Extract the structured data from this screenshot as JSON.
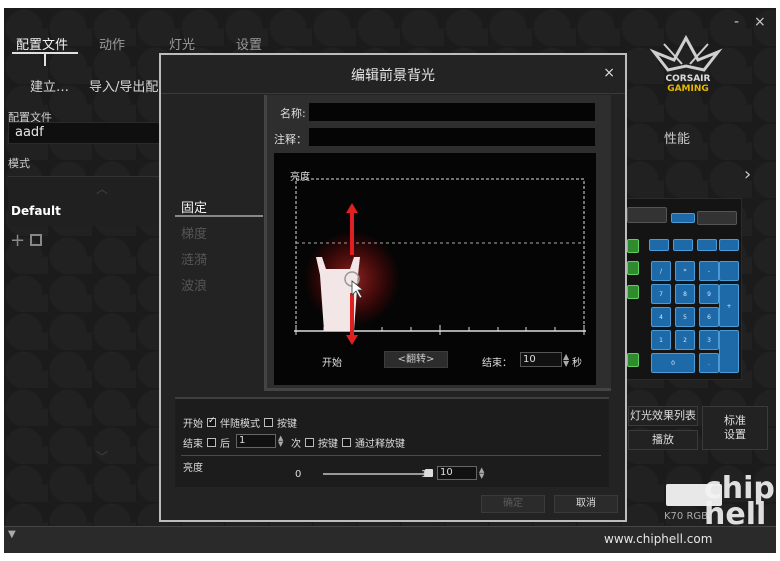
{
  "app": {
    "tabs": [
      {
        "label": "配置文件",
        "active": true
      },
      {
        "label": "动作",
        "active": false
      },
      {
        "label": "灯光",
        "active": false
      },
      {
        "label": "设置",
        "active": false
      }
    ],
    "actions": {
      "create": "建立…",
      "import_export": "导入/导出配"
    },
    "window": {
      "minimize": "-",
      "close": "×"
    },
    "brand": {
      "line1": "CORSAIR",
      "line2": "GAMING"
    },
    "colors": {
      "background": "#1b1b1b",
      "accent_blue": "#1e6aa8",
      "accent_red": "#e02020",
      "key_green": "#2e8b2e"
    }
  },
  "sidebar": {
    "profile_label": "配置文件",
    "profile_value": "aadf",
    "mode_label": "模式",
    "modes": [
      "Default"
    ],
    "add_icon": "plus-icon",
    "import_icon": "import-icon"
  },
  "right_panel": {
    "performance_label": "性能",
    "lighting_list_button": "灯光效果列表",
    "play_button": "播放",
    "standard_settings_button": "标准\n设置",
    "keyboard_model": "K70 RGB"
  },
  "keypad": {
    "rows": [
      [
        "/",
        "*",
        "-"
      ],
      [
        "7",
        "8",
        "9"
      ],
      [
        "4",
        "5",
        "6"
      ],
      [
        "1",
        "2",
        "3"
      ],
      [
        "0",
        "."
      ]
    ]
  },
  "dialog": {
    "title": "编辑前景背光",
    "close": "×",
    "nav": [
      {
        "label": "固定",
        "active": true
      },
      {
        "label": "梯度",
        "active": false
      },
      {
        "label": "涟漪",
        "active": false
      },
      {
        "label": "波浪",
        "active": false
      }
    ],
    "name_label": "名称:",
    "name_value": "",
    "note_label": "注释：",
    "note_value": "",
    "chart": {
      "y_label": "亮度",
      "start_label": "开始",
      "flip_button": "<翻转>",
      "end_label": "结束：",
      "end_value": "10",
      "end_unit": "秒"
    },
    "options": {
      "start_label": "开始",
      "follow_mode_label": "伴随模式",
      "follow_mode_checked": true,
      "start_key_label": "按键",
      "start_key_checked": false,
      "end_label": "结束",
      "after_label": "后",
      "after_checked": false,
      "after_count": "1",
      "times_label": "次",
      "end_key_label": "按键",
      "end_key_checked": false,
      "release_label": "通过释放键",
      "release_checked": false,
      "brightness_label": "亮度",
      "brightness_min": "0",
      "brightness_max": "10",
      "brightness_value": "10"
    },
    "ok_button": "确定",
    "cancel_button": "取消"
  },
  "watermark": {
    "text": "chip hell",
    "url": "www.chiphell.com"
  },
  "footer": {
    "arrow": "▼"
  }
}
